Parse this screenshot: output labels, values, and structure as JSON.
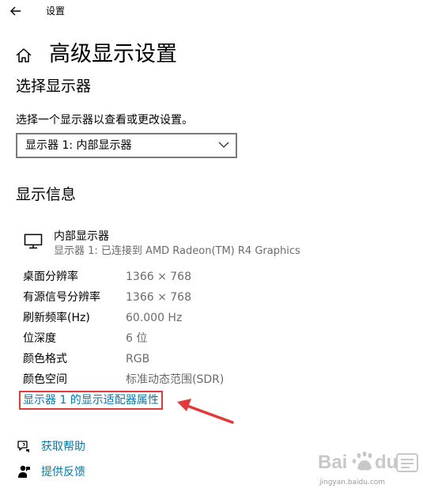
{
  "window": {
    "title": "设置"
  },
  "header": {
    "page_title": "高级显示设置"
  },
  "select_display": {
    "heading": "选择显示器",
    "description": "选择一个显示器以查看或更改设置。",
    "selected": "显示器 1: 内部显示器"
  },
  "display_info": {
    "heading": "显示信息",
    "name": "内部显示器",
    "connection": "显示器 1: 已连接到 AMD Radeon(TM) R4 Graphics",
    "rows": [
      {
        "label": "桌面分辨率",
        "value": "1366 × 768"
      },
      {
        "label": "有源信号分辨率",
        "value": "1366 × 768"
      },
      {
        "label": "刷新频率(Hz)",
        "value": "60.000 Hz"
      },
      {
        "label": "位深度",
        "value": "6 位"
      },
      {
        "label": "颜色格式",
        "value": "RGB"
      },
      {
        "label": "颜色空间",
        "value": "标准动态范围(SDR)"
      }
    ],
    "adapter_link": "显示器 1 的显示适配器属性"
  },
  "footer": {
    "help": "获取帮助",
    "feedback": "提供反馈"
  },
  "watermark": {
    "sub": "jingyan.baidu.com"
  },
  "colors": {
    "link": "#0a78a8",
    "highlight": "#e03a3a",
    "secondary_text": "#6b6b6b"
  },
  "icons": [
    "back-arrow-icon",
    "home-icon",
    "chevron-down-icon",
    "monitor-icon",
    "help-icon",
    "feedback-icon"
  ]
}
